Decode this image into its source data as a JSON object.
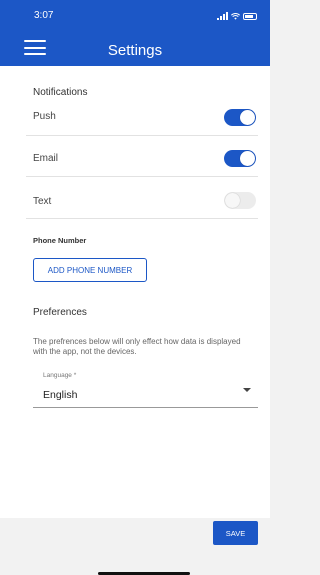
{
  "status_bar": {
    "time": "3:07",
    "icons": [
      "signal-icon",
      "wifi-icon",
      "battery-icon"
    ]
  },
  "header": {
    "title": "Settings",
    "menu_icon": "hamburger-icon"
  },
  "notifications": {
    "title": "Notifications",
    "items": [
      {
        "label": "Push",
        "enabled": true
      },
      {
        "label": "Email",
        "enabled": true
      },
      {
        "label": "Text",
        "enabled": false
      }
    ]
  },
  "phone": {
    "label": "Phone Number",
    "button_label": "ADD PHONE NUMBER"
  },
  "preferences": {
    "title": "Preferences",
    "description": "The prefrences below will only effect how data is displayed with the app, not the devices.",
    "language": {
      "label": "Language *",
      "value": "English"
    }
  },
  "footer": {
    "save_label": "SAVE"
  },
  "colors": {
    "accent": "#1c57c6",
    "toggle_off": "#ececec",
    "footer_bg": "#f2f2f2"
  }
}
